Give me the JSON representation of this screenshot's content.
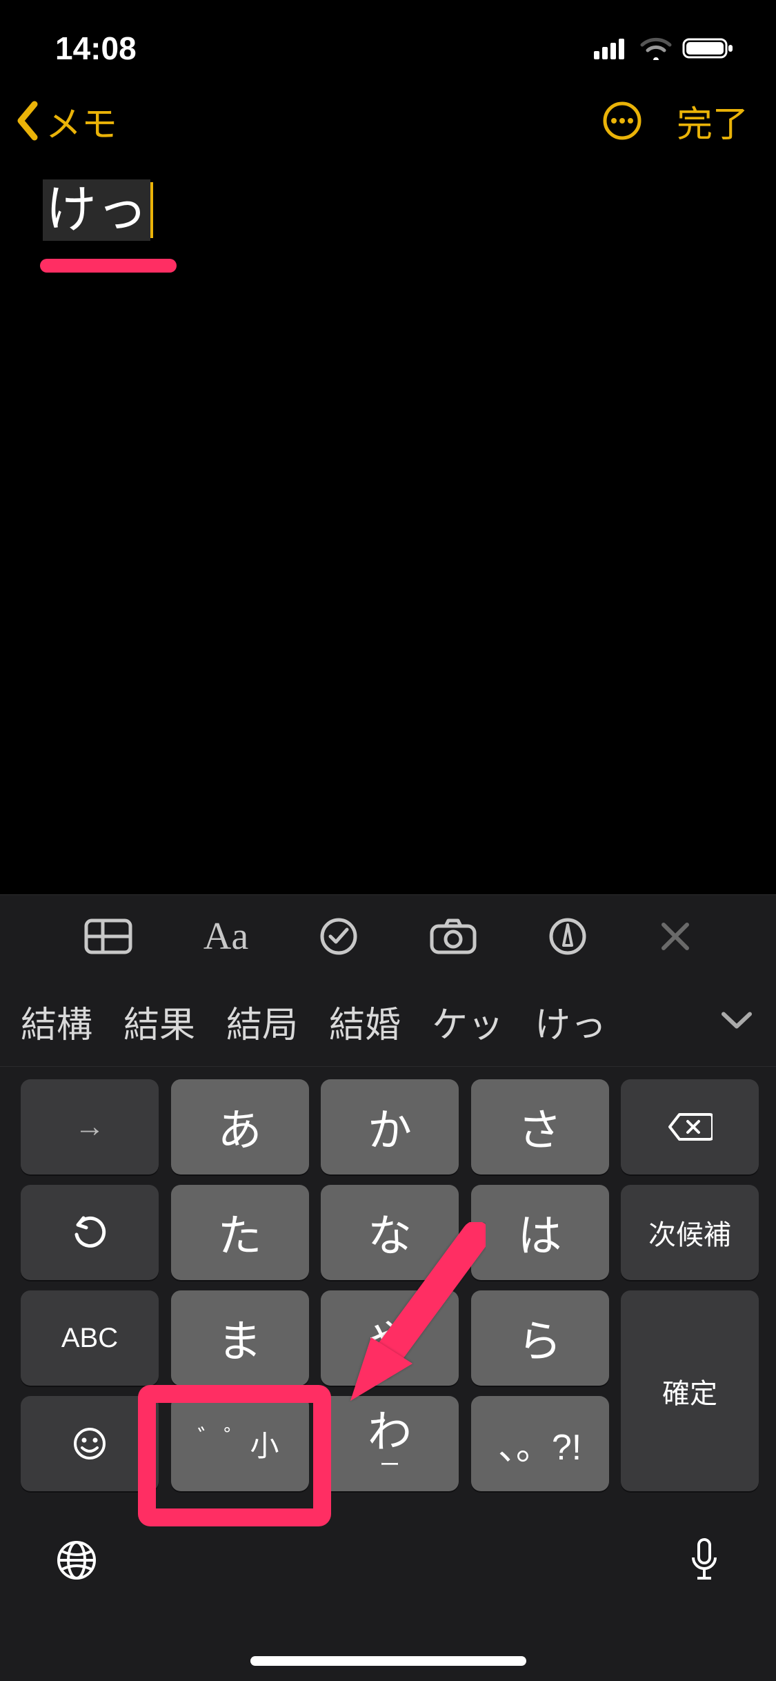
{
  "status": {
    "time": "14:08"
  },
  "nav": {
    "back_label": "メモ",
    "done_label": "完了"
  },
  "editor": {
    "text": "けっ"
  },
  "toolbar_icons": {
    "table": "table-icon",
    "format": "format-icon",
    "check": "check-icon",
    "camera": "camera-icon",
    "draw": "draw-icon",
    "close": "close-icon"
  },
  "suggestions": [
    "結構",
    "結果",
    "結局",
    "結婚",
    "ケッ",
    "けっ"
  ],
  "keys": {
    "arrow": "→",
    "a": "あ",
    "ka": "か",
    "sa": "さ",
    "undo": "undo",
    "ta": "た",
    "na": "な",
    "ha": "は",
    "next_candidate": "次候補",
    "abc": "ABC",
    "ma": "ま",
    "ya": "や",
    "ra": "ら",
    "confirm": "確定",
    "emoji": "emoji",
    "small": "゛゜小",
    "wa": "わ",
    "wa_sub": "ー",
    "punct": "、。?!"
  },
  "annotations": {
    "highlighted_key": "small-key",
    "highlight_color": "#ff2e63"
  }
}
